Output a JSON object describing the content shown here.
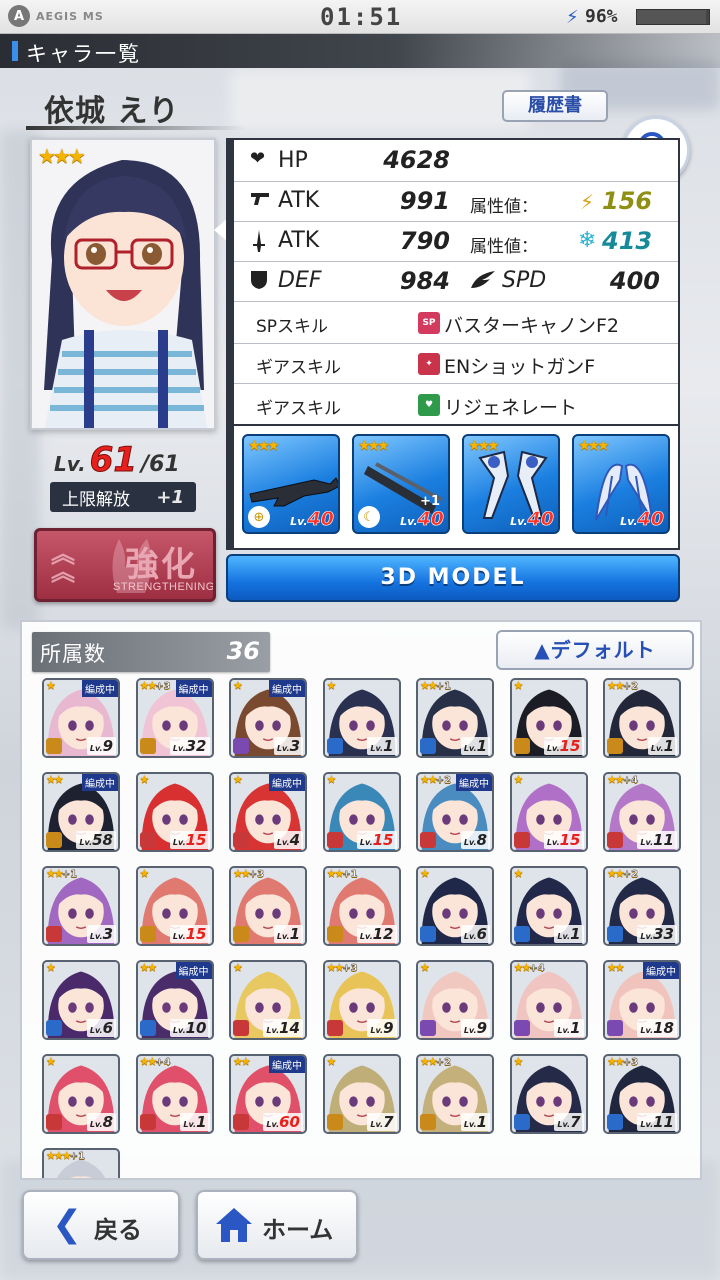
{
  "status": {
    "app": "AEGIS MS",
    "time": "01:51",
    "battery": "96%",
    "battery_level": 0.96
  },
  "header": {
    "title": "キャラ一覧"
  },
  "character": {
    "name": "依城 えり",
    "resume_label": "履歴書",
    "stars": "★★★",
    "level_prefix": "Lv.",
    "level": "61",
    "level_max": "/61",
    "limit_break_label": "上限解放",
    "limit_break_value": "+1",
    "strengthen_label": "強化",
    "strengthen_sub": "STRENGTHENING"
  },
  "stats": {
    "hp_label": "HP",
    "hp": "4628",
    "atk1_label": "ATK",
    "atk1": "991",
    "atk2_label": "ATK",
    "atk2": "790",
    "def_label": "DEF",
    "def": "984",
    "spd_label": "SPD",
    "spd": "400",
    "attr_label": "属性値：",
    "attr1": "156",
    "attr1_color": "#9a9a1a",
    "attr2": "413",
    "attr2_color": "#1a8fa0"
  },
  "skills": [
    {
      "type": "SPスキル",
      "icon": "SP",
      "name": "バスターキャノンF2",
      "color": "#d23b5e"
    },
    {
      "type": "ギアスキル",
      "icon": "gear-red",
      "name": "ENショットガンF",
      "color": "#c9344a"
    },
    {
      "type": "ギアスキル",
      "icon": "gear-green",
      "name": "リジェネレート",
      "color": "#2f9a4a"
    }
  ],
  "gears": [
    {
      "stars": "★★★",
      "lv_prefix": "Lv.",
      "lv": "40",
      "extra": ""
    },
    {
      "stars": "★★★",
      "lv_prefix": "Lv.",
      "lv": "40",
      "extra": "+1"
    },
    {
      "stars": "★★★",
      "lv_prefix": "Lv.",
      "lv": "40",
      "extra": ""
    },
    {
      "stars": "★★★",
      "lv_prefix": "Lv.",
      "lv": "40",
      "extra": ""
    }
  ],
  "model_button": "3D MODEL",
  "roster": {
    "owned_label": "所属数",
    "owned_count": "36",
    "sort_label": "▲デフォルト",
    "deploy_label": "編成中",
    "lv_prefix": "Lv.",
    "cards": [
      {
        "stars": "★",
        "plus": "",
        "deploy": true,
        "lv": "9",
        "red": false,
        "hair": "#e8b8d0",
        "cls": "#c98a1a"
      },
      {
        "stars": "★★",
        "plus": "+3",
        "deploy": true,
        "lv": "32",
        "red": false,
        "hair": "#f0c4d4",
        "cls": "#c98a1a"
      },
      {
        "stars": "★",
        "plus": "",
        "deploy": true,
        "lv": "3",
        "red": false,
        "hair": "#7a4a30",
        "cls": "#7a4ab0"
      },
      {
        "stars": "★",
        "plus": "",
        "deploy": false,
        "lv": "1",
        "red": false,
        "hair": "#2a3050",
        "cls": "#2a6ac8"
      },
      {
        "stars": "★★",
        "plus": "+1",
        "deploy": false,
        "lv": "1",
        "red": false,
        "hair": "#283048",
        "cls": "#2a6ac8"
      },
      {
        "stars": "★",
        "plus": "",
        "deploy": false,
        "lv": "15",
        "red": true,
        "hair": "#1c1c26",
        "cls": "#c98a1a"
      },
      {
        "stars": "★★",
        "plus": "+2",
        "deploy": false,
        "lv": "1",
        "red": false,
        "hair": "#22283a",
        "cls": "#c98a1a"
      },
      {
        "stars": "★★",
        "plus": "",
        "deploy": true,
        "lv": "58",
        "red": false,
        "hair": "#1e2230",
        "cls": "#c98a1a"
      },
      {
        "stars": "★",
        "plus": "",
        "deploy": false,
        "lv": "15",
        "red": true,
        "hair": "#d83030",
        "cls": "#c93838"
      },
      {
        "stars": "★",
        "plus": "",
        "deploy": true,
        "lv": "4",
        "red": false,
        "hair": "#d83434",
        "cls": "#c93838"
      },
      {
        "stars": "★",
        "plus": "",
        "deploy": false,
        "lv": "15",
        "red": true,
        "hair": "#3a88b8",
        "cls": "#c93838"
      },
      {
        "stars": "★★",
        "plus": "+2",
        "deploy": true,
        "lv": "8",
        "red": false,
        "hair": "#4a8cc0",
        "cls": "#c93838"
      },
      {
        "stars": "★",
        "plus": "",
        "deploy": false,
        "lv": "15",
        "red": true,
        "hair": "#b070c8",
        "cls": "#c93838"
      },
      {
        "stars": "★★",
        "plus": "+4",
        "deploy": false,
        "lv": "11",
        "red": false,
        "hair": "#b478c8",
        "cls": "#c93838"
      },
      {
        "stars": "★★",
        "plus": "+1",
        "deploy": false,
        "lv": "3",
        "red": false,
        "hair": "#a068c0",
        "cls": "#c93838"
      },
      {
        "stars": "★",
        "plus": "",
        "deploy": false,
        "lv": "15",
        "red": true,
        "hair": "#e07a70",
        "cls": "#c98a1a"
      },
      {
        "stars": "★★",
        "plus": "+3",
        "deploy": false,
        "lv": "1",
        "red": false,
        "hair": "#e07a70",
        "cls": "#c98a1a"
      },
      {
        "stars": "★★",
        "plus": "+1",
        "deploy": false,
        "lv": "12",
        "red": false,
        "hair": "#e07a70",
        "cls": "#c98a1a"
      },
      {
        "stars": "★",
        "plus": "",
        "deploy": false,
        "lv": "6",
        "red": false,
        "hair": "#20284a",
        "cls": "#2a6ac8"
      },
      {
        "stars": "★",
        "plus": "",
        "deploy": false,
        "lv": "1",
        "red": false,
        "hair": "#22284a",
        "cls": "#2a6ac8"
      },
      {
        "stars": "★★",
        "plus": "+2",
        "deploy": false,
        "lv": "33",
        "red": false,
        "hair": "#222a48",
        "cls": "#2a6ac8"
      },
      {
        "stars": "★",
        "plus": "",
        "deploy": false,
        "lv": "6",
        "red": false,
        "hair": "#4a2a6a",
        "cls": "#2a6ac8"
      },
      {
        "stars": "★★",
        "plus": "",
        "deploy": true,
        "lv": "10",
        "red": false,
        "hair": "#4a2c6a",
        "cls": "#2a6ac8"
      },
      {
        "stars": "★",
        "plus": "",
        "deploy": false,
        "lv": "14",
        "red": false,
        "hair": "#e8c860",
        "cls": "#c93838"
      },
      {
        "stars": "★★",
        "plus": "+3",
        "deploy": false,
        "lv": "9",
        "red": false,
        "hair": "#e8c458",
        "cls": "#c93838"
      },
      {
        "stars": "★",
        "plus": "",
        "deploy": false,
        "lv": "9",
        "red": false,
        "hair": "#f0c8c0",
        "cls": "#7a4ab0"
      },
      {
        "stars": "★★",
        "plus": "+4",
        "deploy": false,
        "lv": "1",
        "red": false,
        "hair": "#f0c4c0",
        "cls": "#7a4ab0"
      },
      {
        "stars": "★★",
        "plus": "",
        "deploy": true,
        "lv": "18",
        "red": false,
        "hair": "#f0c4bc",
        "cls": "#7a4ab0"
      },
      {
        "stars": "★",
        "plus": "",
        "deploy": false,
        "lv": "8",
        "red": false,
        "hair": "#e0506a",
        "cls": "#c93838"
      },
      {
        "stars": "★★",
        "plus": "+4",
        "deploy": false,
        "lv": "1",
        "red": false,
        "hair": "#e0506a",
        "cls": "#c93838"
      },
      {
        "stars": "★★",
        "plus": "",
        "deploy": true,
        "lv": "60",
        "red": true,
        "hair": "#e05068",
        "cls": "#c93838"
      },
      {
        "stars": "★",
        "plus": "",
        "deploy": false,
        "lv": "7",
        "red": false,
        "hair": "#c0ae78",
        "cls": "#c98a1a"
      },
      {
        "stars": "★★",
        "plus": "+2",
        "deploy": false,
        "lv": "1",
        "red": false,
        "hair": "#c4b07a",
        "cls": "#c98a1a"
      },
      {
        "stars": "★",
        "plus": "",
        "deploy": false,
        "lv": "7",
        "red": false,
        "hair": "#252a48",
        "cls": "#2a6ac8"
      },
      {
        "stars": "★★",
        "plus": "+3",
        "deploy": false,
        "lv": "11",
        "red": false,
        "hair": "#20263e",
        "cls": "#2a6ac8"
      },
      {
        "stars": "★★★",
        "plus": "+1",
        "deploy": false,
        "lv": "",
        "red": false,
        "hair": "#c8ccd6",
        "cls": "#c8ccd6"
      }
    ]
  },
  "nav": {
    "back_label": "戻る",
    "home_label": "ホーム"
  }
}
